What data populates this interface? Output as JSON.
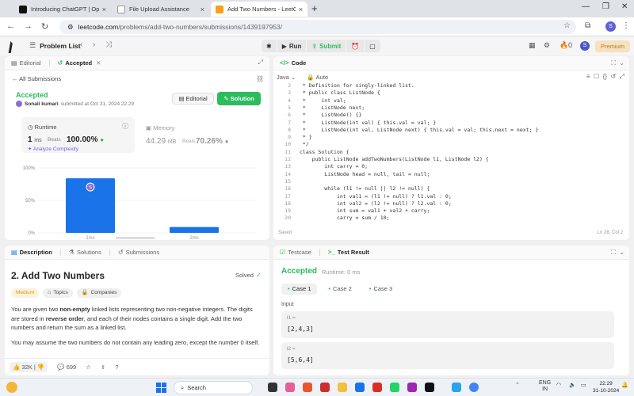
{
  "browser": {
    "tabs": [
      {
        "title": "Introducing ChatGPT | OpenAI",
        "color": "#111111"
      },
      {
        "title": "File Upload Assistance",
        "color": "#444444"
      },
      {
        "title": "Add Two Numbers - LeetCode",
        "color": "#f89f1b"
      }
    ],
    "url_host": "leetcode.com",
    "url_path": "/problems/add-two-numbers/submissions/1439197953/",
    "profile_initial": "S"
  },
  "header": {
    "problem_list": "Problem List",
    "run": "Run",
    "submit": "Submit",
    "streak": "0",
    "avatar_initial": "S",
    "premium": "Premium"
  },
  "submission_panel": {
    "tabs": [
      "Editorial",
      "Accepted"
    ],
    "all_submissions": "All Submissions",
    "status": "Accepted",
    "author": "Sonali kumari",
    "submitted_at": "submitted at Oct 31, 2024 22:29",
    "editorial_btn": "Editorial",
    "solution_btn": "Solution",
    "runtime_label": "Runtime",
    "runtime_value": "1",
    "runtime_unit": "ms",
    "beats_label": "Beats",
    "runtime_beats": "100.00%",
    "analyze": "Analyze Complexity",
    "memory_label": "Memory",
    "memory_value": "44.29",
    "memory_unit": "MB",
    "memory_beats": "70.26%"
  },
  "chart_data": {
    "type": "bar",
    "categories": [
      "1ms",
      "2ms"
    ],
    "values": [
      84,
      9
    ],
    "ylim": [
      0,
      100
    ],
    "yticks": [
      "0%",
      "50%",
      "100%"
    ],
    "grid": true,
    "highlight_index": 0,
    "highlight_label": "S",
    "bar_color": "#1a73e8"
  },
  "code_panel": {
    "tab": "Code",
    "language": "Java",
    "autocomplete": "Auto",
    "saved": "Saved",
    "cursor": "Ln 28, Col 2",
    "lines": [
      {
        "n": "2",
        "t": " * Definition for singly-linked list."
      },
      {
        "n": "3",
        "t": " * public class ListNode {"
      },
      {
        "n": "4",
        "t": " *     int val;"
      },
      {
        "n": "5",
        "t": " *     ListNode next;"
      },
      {
        "n": "6",
        "t": " *     ListNode() {}"
      },
      {
        "n": "7",
        "t": " *     ListNode(int val) { this.val = val; }"
      },
      {
        "n": "8",
        "t": " *     ListNode(int val, ListNode next) { this.val = val; this.next = next; }"
      },
      {
        "n": "9",
        "t": " * }"
      },
      {
        "n": "10",
        "t": " */"
      },
      {
        "n": "11",
        "t": "class Solution {"
      },
      {
        "n": "12",
        "t": "    public ListNode addTwoNumbers(ListNode l1, ListNode l2) {"
      },
      {
        "n": "13",
        "t": "        int carry = 0;"
      },
      {
        "n": "14",
        "t": "        ListNode head = null, tail = null;"
      },
      {
        "n": "15",
        "t": ""
      },
      {
        "n": "16",
        "t": "        while (l1 != null || l2 != null) {"
      },
      {
        "n": "17",
        "t": "            int val1 = (l1 != null) ? l1.val : 0;"
      },
      {
        "n": "18",
        "t": "            int val2 = (l2 != null) ? l2.val : 0;"
      },
      {
        "n": "19",
        "t": "            int sum = val1 + val2 + carry;"
      },
      {
        "n": "20",
        "t": "            carry = sum / 10;"
      }
    ]
  },
  "description_panel": {
    "tabs": [
      "Description",
      "Solutions",
      "Submissions"
    ],
    "title": "2. Add Two Numbers",
    "solved": "Solved",
    "difficulty": "Medium",
    "topics": "Topics",
    "companies": "Companies",
    "p1": [
      "You are given two ",
      "non-empty",
      " linked lists representing two non-negative integers. The digits are stored in ",
      "reverse order",
      ", and each of their nodes contains a single digit. Add the two numbers and return the sum as a linked list."
    ],
    "p2": "You may assume the two numbers do not contain any leading zero, except the number 0 itself.",
    "likes": "32K",
    "comments": "699"
  },
  "test_panel": {
    "tabs": [
      "Testcase",
      "Test Result"
    ],
    "status": "Accepted",
    "runtime": "Runtime: 0 ms",
    "cases": [
      "Case 1",
      "Case 2",
      "Case 3"
    ],
    "input_label": "Input",
    "inputs": [
      {
        "name": "l1 =",
        "value": "[2,4,3]"
      },
      {
        "name": "l2 =",
        "value": "[5,6,4]"
      }
    ]
  },
  "taskbar": {
    "search": "Search",
    "lang": "ENG",
    "region": "IN",
    "time": "22:29",
    "date": "31-10-2024"
  }
}
